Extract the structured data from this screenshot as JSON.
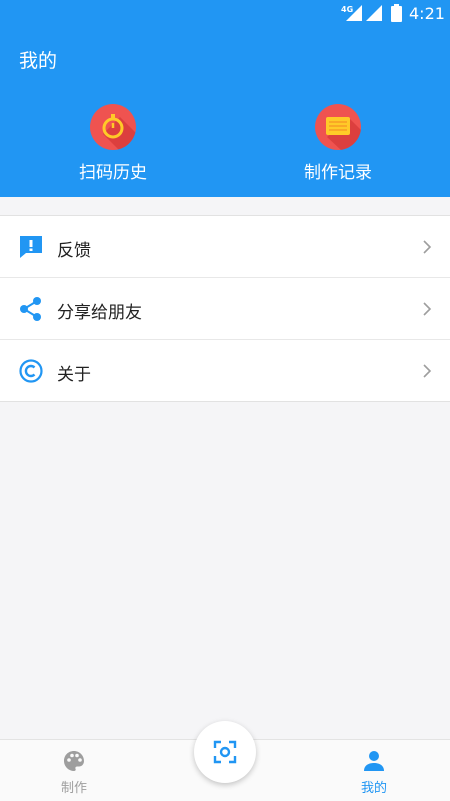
{
  "status_bar": {
    "network": "4G",
    "time": "4:21"
  },
  "header": {
    "title": "我的",
    "shortcuts": [
      {
        "label": "扫码历史",
        "icon": "stopwatch-icon"
      },
      {
        "label": "制作记录",
        "icon": "document-icon"
      }
    ]
  },
  "menu": {
    "items": [
      {
        "label": "反馈",
        "icon": "feedback-icon"
      },
      {
        "label": "分享给朋友",
        "icon": "share-icon"
      },
      {
        "label": "关于",
        "icon": "copyright-icon"
      }
    ]
  },
  "bottom_nav": {
    "items": [
      {
        "label": "制作",
        "icon": "palette-icon",
        "active": false
      },
      {
        "label": "我的",
        "icon": "person-icon",
        "active": true
      }
    ],
    "fab_icon": "scan-icon"
  },
  "colors": {
    "primary": "#2196f3",
    "shortcut_circle": "#ef5350",
    "inactive": "#9e9e9e",
    "background": "#f5f5f7"
  }
}
